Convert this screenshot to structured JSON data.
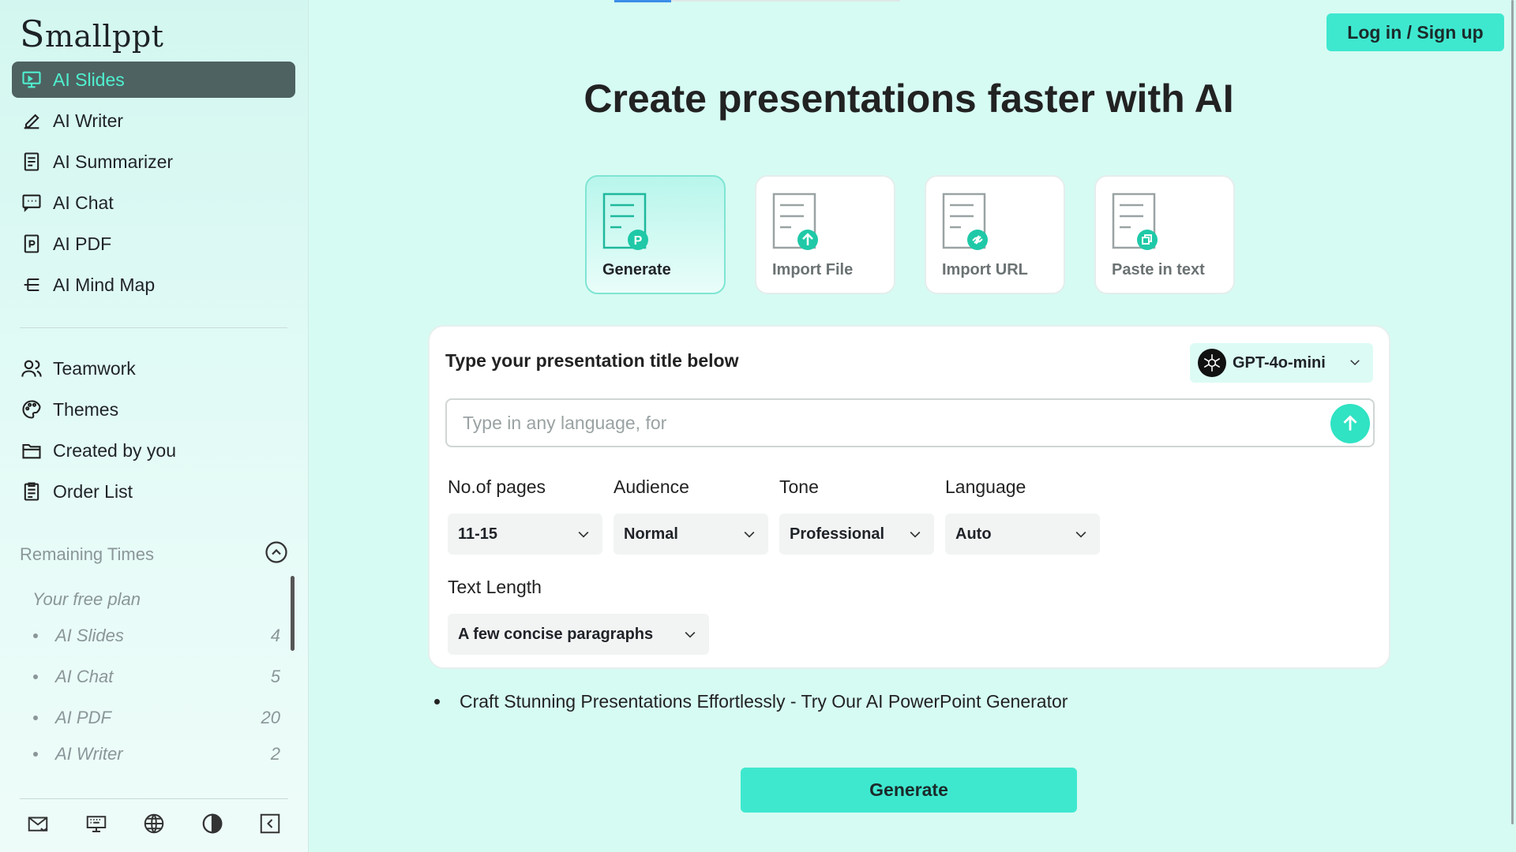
{
  "app": {
    "logo_first": "S",
    "logo_rest": "mallppt"
  },
  "sidebar": {
    "items": [
      {
        "label": "AI Slides",
        "icon": "presentation-icon",
        "active": true
      },
      {
        "label": "AI Writer",
        "icon": "pen-icon"
      },
      {
        "label": "AI Summarizer",
        "icon": "document-icon"
      },
      {
        "label": "AI Chat",
        "icon": "chat-icon"
      },
      {
        "label": "AI PDF",
        "icon": "pdf-icon"
      },
      {
        "label": "AI Mind Map",
        "icon": "mindmap-icon"
      }
    ],
    "items2": [
      {
        "label": "Teamwork",
        "icon": "team-icon"
      },
      {
        "label": "Themes",
        "icon": "palette-icon"
      },
      {
        "label": "Created by you",
        "icon": "folder-icon"
      },
      {
        "label": "Order List",
        "icon": "clipboard-icon"
      }
    ],
    "remaining": {
      "title": "Remaining Times",
      "plan": "Your free plan",
      "rows": [
        {
          "label": "AI Slides",
          "count": "4"
        },
        {
          "label": "AI Chat",
          "count": "5"
        },
        {
          "label": "AI PDF",
          "count": "20"
        },
        {
          "label": "AI Writer",
          "count": "2"
        }
      ]
    },
    "bottom_icons": [
      "mail-icon",
      "keyboard-icon",
      "globe-icon",
      "contrast-icon",
      "collapse-icon"
    ]
  },
  "header": {
    "login_label": "Log in / Sign up"
  },
  "main": {
    "headline": "Create presentations faster with AI",
    "modes": [
      {
        "label": "Generate",
        "badge": "P",
        "active": true
      },
      {
        "label": "Import File",
        "badge": "upload"
      },
      {
        "label": "Import URL",
        "badge": "link"
      },
      {
        "label": "Paste in text",
        "badge": "copy"
      }
    ],
    "panel": {
      "title": "Type your presentation title below",
      "model": "GPT-4o-mini",
      "prompt_placeholder": "Type in any language, for",
      "fields": [
        {
          "label": "No.of pages",
          "value": "11-15"
        },
        {
          "label": "Audience",
          "value": "Normal"
        },
        {
          "label": "Tone",
          "value": "Professional"
        },
        {
          "label": "Language",
          "value": "Auto"
        }
      ],
      "text_length": {
        "label": "Text Length",
        "value": "A few concise paragraphs"
      }
    },
    "bullet": "Craft Stunning Presentations Effortlessly - Try Our AI PowerPoint Generator",
    "generate_label": "Generate"
  },
  "colors": {
    "accent": "#3ee8cf",
    "active_nav_bg": "#4e6261",
    "active_nav_text": "#4ff0d0"
  }
}
